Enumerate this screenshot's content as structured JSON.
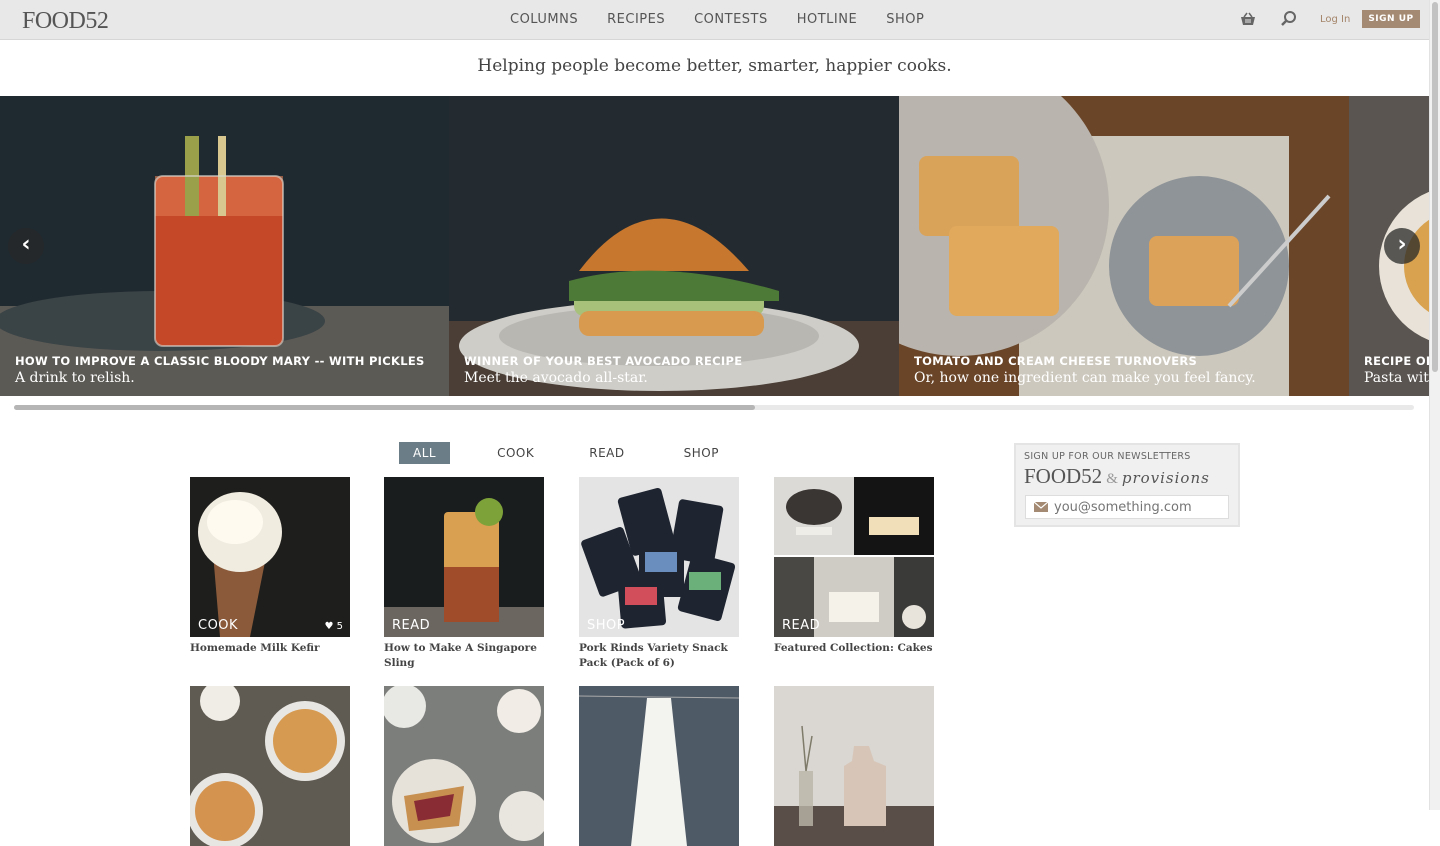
{
  "header": {
    "logo": "FOOD52",
    "nav": [
      "COLUMNS",
      "RECIPES",
      "CONTESTS",
      "HOTLINE",
      "SHOP"
    ],
    "login": "Log In",
    "signup": "SIGN UP",
    "icons": [
      "basket-icon",
      "search-icon"
    ]
  },
  "tagline": "Helping people become better, smarter, happier cooks.",
  "carousel": {
    "slides": [
      {
        "title": "HOW TO IMPROVE A CLASSIC BLOODY MARY -- WITH PICKLES",
        "subtitle": "A drink to relish."
      },
      {
        "title": "WINNER OF YOUR BEST AVOCADO RECIPE",
        "subtitle": "Meet the avocado all-star."
      },
      {
        "title": "TOMATO AND CREAM CHEESE TURNOVERS",
        "subtitle": "Or, how one ingredient can make you feel fancy."
      },
      {
        "title": "RECIPE OF",
        "subtitle": "Pasta wit"
      }
    ],
    "prev": "‹",
    "next": "›"
  },
  "filters": [
    "ALL",
    "COOK",
    "READ",
    "SHOP"
  ],
  "tiles": [
    {
      "tag": "COOK",
      "likes": "♥ 5",
      "title": "Homemade Milk Kefir"
    },
    {
      "tag": "READ",
      "likes": "",
      "title": "How to Make A Singapore Sling"
    },
    {
      "tag": "SHOP",
      "likes": "",
      "title": "Pork Rinds Variety Snack Pack (Pack of 6)"
    },
    {
      "tag": "READ",
      "likes": "",
      "title": "Featured Collection: Cakes"
    }
  ],
  "newsletter": {
    "heading": "SIGN UP FOR OUR NEWSLETTERS",
    "brand1": "FOOD52",
    "amp": "&",
    "brand2": "provisions",
    "placeholder": "you@something.com"
  },
  "colors": {
    "accent": "#a48a72",
    "filter_active": "#6b7d86"
  }
}
